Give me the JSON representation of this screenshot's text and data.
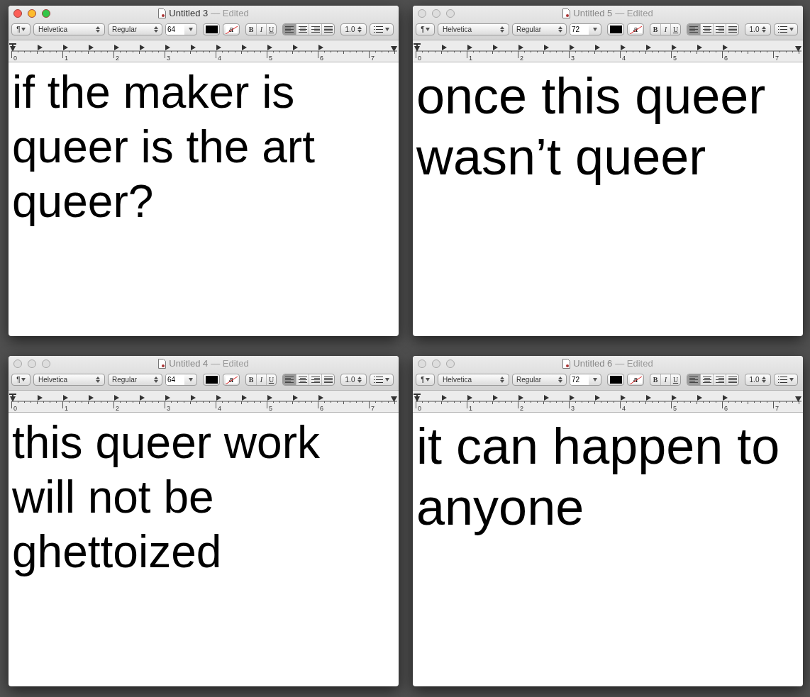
{
  "windows": [
    {
      "title": "Untitled 3",
      "status": "— Edited",
      "active": true,
      "toolbar": {
        "paragraph": "¶",
        "font": "Helvetica",
        "style": "Regular",
        "size": "64",
        "background_sample": "a",
        "bold": "B",
        "italic": "I",
        "underline": "U",
        "alignments": [
          {
            "kind": "left",
            "selected": true
          },
          {
            "kind": "center",
            "selected": false
          },
          {
            "kind": "right",
            "selected": false
          },
          {
            "kind": "justify",
            "selected": false
          }
        ],
        "line_spacing": "1.0"
      },
      "ruler": [
        "0",
        "1",
        "2",
        "3",
        "4",
        "5",
        "6",
        "7"
      ],
      "body": "if the maker is queer is the art queer?"
    },
    {
      "title": "Untitled 5",
      "status": "— Edited",
      "active": false,
      "toolbar": {
        "paragraph": "¶",
        "font": "Helvetica",
        "style": "Regular",
        "size": "72",
        "background_sample": "a",
        "bold": "B",
        "italic": "I",
        "underline": "U",
        "alignments": [
          {
            "kind": "left",
            "selected": true
          },
          {
            "kind": "center",
            "selected": false
          },
          {
            "kind": "right",
            "selected": false
          },
          {
            "kind": "justify",
            "selected": false
          }
        ],
        "line_spacing": "1.0"
      },
      "ruler": [
        "0",
        "1",
        "2",
        "3",
        "4",
        "5",
        "6",
        "7"
      ],
      "body": "once this queer wasn’t queer"
    },
    {
      "title": "Untitled 4",
      "status": "— Edited",
      "active": false,
      "toolbar": {
        "paragraph": "¶",
        "font": "Helvetica",
        "style": "Regular",
        "size": "64",
        "background_sample": "a",
        "bold": "B",
        "italic": "I",
        "underline": "U",
        "alignments": [
          {
            "kind": "left",
            "selected": true
          },
          {
            "kind": "center",
            "selected": false
          },
          {
            "kind": "right",
            "selected": false
          },
          {
            "kind": "justify",
            "selected": false
          }
        ],
        "line_spacing": "1.0"
      },
      "ruler": [
        "0",
        "1",
        "2",
        "3",
        "4",
        "5",
        "6",
        "7"
      ],
      "body": "this queer work will not be ghettoized"
    },
    {
      "title": "Untitled 6",
      "status": "— Edited",
      "active": false,
      "toolbar": {
        "paragraph": "¶",
        "font": "Helvetica",
        "style": "Regular",
        "size": "72",
        "background_sample": "a",
        "bold": "B",
        "italic": "I",
        "underline": "U",
        "alignments": [
          {
            "kind": "left",
            "selected": true
          },
          {
            "kind": "center",
            "selected": false
          },
          {
            "kind": "right",
            "selected": false
          },
          {
            "kind": "justify",
            "selected": false
          }
        ],
        "line_spacing": "1.0"
      },
      "ruler": [
        "0",
        "1",
        "2",
        "3",
        "4",
        "5",
        "6",
        "7"
      ],
      "body": "it can happen to anyone"
    }
  ]
}
